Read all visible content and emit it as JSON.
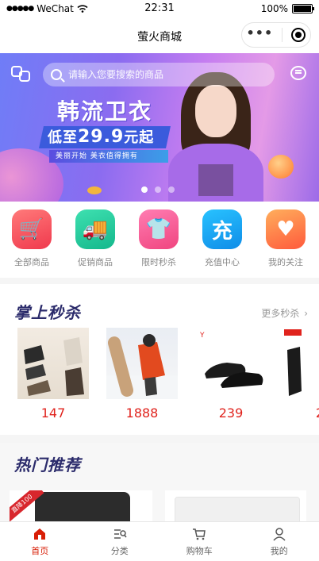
{
  "status_bar": {
    "signal": "●●●●●",
    "carrier": "WeChat",
    "time": "22:31",
    "battery_percent": "100%"
  },
  "navbar": {
    "title": "萤火商城",
    "more_icon": "ellipsis-icon",
    "close_icon": "target-close-icon"
  },
  "banner": {
    "search_placeholder": "请输入您要搜索的商品",
    "headline": "韩流卫衣",
    "price_prefix": "低至",
    "price_value": "29.9",
    "price_suffix": "元起",
    "subtitle": "美丽开始 美衣值得拥有",
    "active_slide": 1,
    "slide_count": 3
  },
  "categories": [
    {
      "label": "全部商品",
      "icon": "cart-icon",
      "color": "#f0394d",
      "glyph": "🛒"
    },
    {
      "label": "促销商品",
      "icon": "truck-icon",
      "color": "#14b88c",
      "glyph": "🚚"
    },
    {
      "label": "限时秒杀",
      "icon": "shirt-icon",
      "color": "#f0457f",
      "glyph": "👕"
    },
    {
      "label": "充值中心",
      "icon": "recharge-icon",
      "color": "#0f8de8",
      "glyph": "充"
    },
    {
      "label": "我的关注",
      "icon": "heart-icon",
      "color": "#ff5a3c",
      "glyph": "♥"
    }
  ],
  "flash_sale": {
    "title": "掌上秒杀",
    "more_label": "更多秒杀",
    "products": [
      {
        "price": "147"
      },
      {
        "price": "1888"
      },
      {
        "price": "239"
      },
      {
        "price": "2"
      }
    ]
  },
  "hot": {
    "title": "热门推荐",
    "ribbon_text": "直降100"
  },
  "tabbar": {
    "active_index": 0,
    "active_color": "#d81e06",
    "items": [
      {
        "label": "首页",
        "icon": "home-icon"
      },
      {
        "label": "分类",
        "icon": "category-icon"
      },
      {
        "label": "购物车",
        "icon": "cart-icon"
      },
      {
        "label": "我的",
        "icon": "user-icon"
      }
    ]
  }
}
